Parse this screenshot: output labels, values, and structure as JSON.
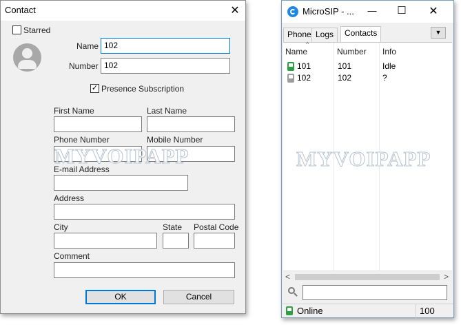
{
  "contact_dialog": {
    "title": "Contact",
    "starred_label": "Starred",
    "starred_checked": false,
    "name_label": "Name",
    "name_value": "102",
    "number_label": "Number",
    "number_value": "102",
    "presence_label": "Presence Subscription",
    "presence_checked": true,
    "first_name_label": "First Name",
    "first_name_value": "",
    "last_name_label": "Last Name",
    "last_name_value": "",
    "phone_number_label": "Phone Number",
    "phone_number_value": "",
    "mobile_number_label": "Mobile Number",
    "mobile_number_value": "",
    "email_label": "E-mail Address",
    "email_value": "",
    "address_label": "Address",
    "address_value": "",
    "city_label": "City",
    "city_value": "",
    "state_label": "State",
    "state_value": "",
    "postal_code_label": "Postal Code",
    "postal_code_value": "",
    "comment_label": "Comment",
    "comment_value": "",
    "ok_label": "OK",
    "cancel_label": "Cancel",
    "close_glyph": "✕",
    "watermark": "MYVOIPAPP"
  },
  "microsip": {
    "title": "MicroSIP - ...",
    "minimize_glyph": "—",
    "maximize_glyph": "☐",
    "close_glyph": "✕",
    "tabs": [
      "Phone",
      "Logs",
      "Contacts"
    ],
    "active_tab": "Contacts",
    "menu_glyph": "▼",
    "columns": [
      "Name",
      "Number",
      "Info"
    ],
    "sort_glyph": "^",
    "contacts": [
      {
        "name": "101",
        "number": "101",
        "info": "Idle",
        "status_color": "#2ea043"
      },
      {
        "name": "102",
        "number": "102",
        "info": "?",
        "status_color": "#9e9e9e"
      }
    ],
    "scroll_left_glyph": "<",
    "scroll_right_glyph": ">",
    "search_placeholder": "",
    "status_text": "Online",
    "status_color": "#2ea043",
    "volume": "100",
    "watermark": "MYVOIPAPP"
  },
  "colors": {
    "accent": "#0078d7",
    "app_icon": "#1e88e5"
  }
}
